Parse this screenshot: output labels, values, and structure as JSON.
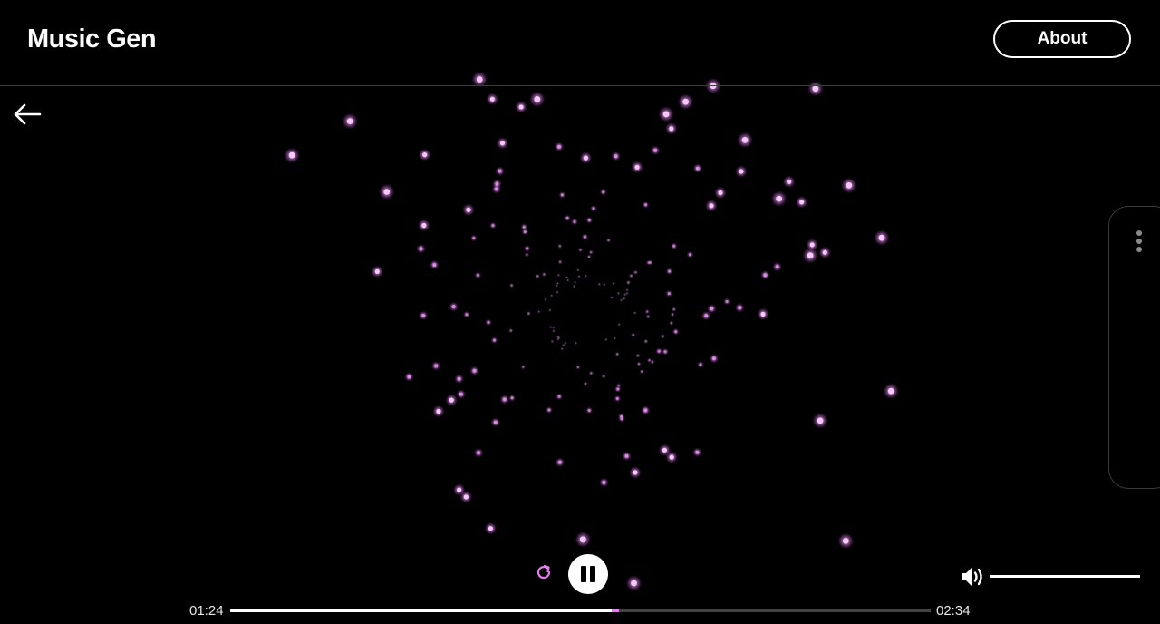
{
  "header": {
    "title": "Music Gen",
    "about_label": "About"
  },
  "icons": {
    "back": "arrow-left-icon",
    "menu": "kebab-menu-icon",
    "replay": "replay-icon",
    "pause": "pause-icon",
    "volume": "volume-icon"
  },
  "player": {
    "state": "playing",
    "current_time": "01:24",
    "total_time": "02:34",
    "progress_fraction": 0.545,
    "volume_fraction": 1.0
  },
  "colors": {
    "particle": "#e88ef5",
    "accent": "#e57cf0",
    "background": "#000000"
  }
}
